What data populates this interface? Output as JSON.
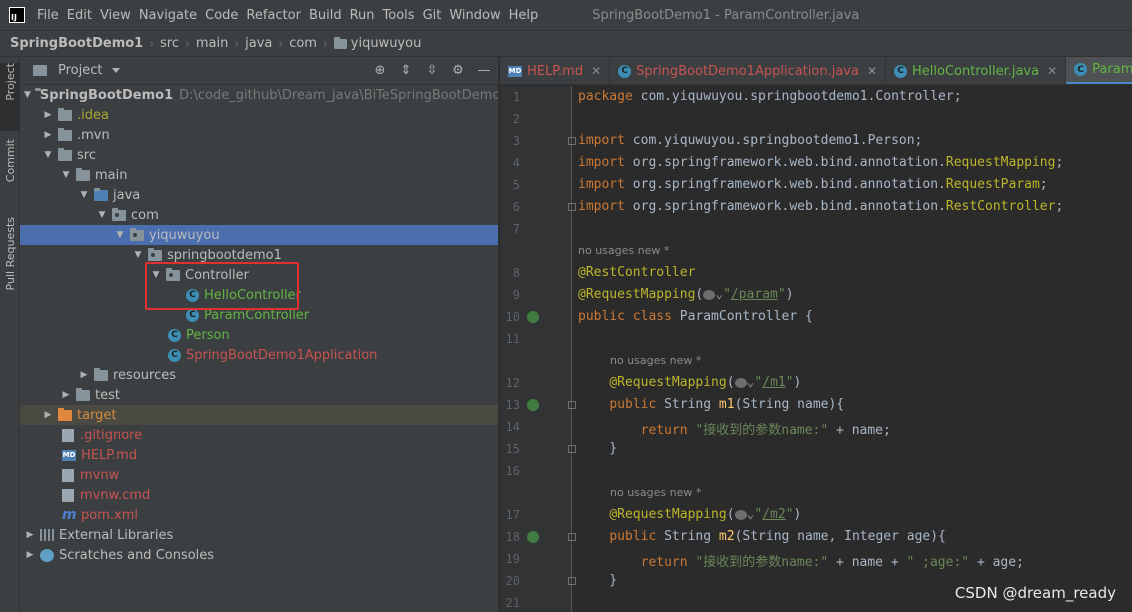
{
  "menubar": {
    "items": [
      "File",
      "Edit",
      "View",
      "Navigate",
      "Code",
      "Refactor",
      "Build",
      "Run",
      "Tools",
      "Git",
      "Window",
      "Help"
    ],
    "window_title": "SpringBootDemo1 - ParamController.java",
    "logo_text": "IJ"
  },
  "breadcrumb": [
    "SpringBootDemo1",
    "src",
    "main",
    "java",
    "com",
    "yiquwuyou"
  ],
  "toolstripe": {
    "project": "Project",
    "commit": "Commit",
    "pull_requests": "Pull Requests"
  },
  "project_panel": {
    "title": "Project",
    "tree": [
      {
        "name": "SpringBootDemo1",
        "extra": "D:\\code_github\\Dream_java\\BiTeSpringBootDemo\\Spri"
      },
      {
        "name": ".idea"
      },
      {
        "name": ".mvn"
      },
      {
        "name": "src"
      },
      {
        "name": "main"
      },
      {
        "name": "java"
      },
      {
        "name": "com"
      },
      {
        "name": "yiquwuyou"
      },
      {
        "name": "springbootdemo1"
      },
      {
        "name": "Controller"
      },
      {
        "name": "HelloController"
      },
      {
        "name": "ParamController"
      },
      {
        "name": "Person"
      },
      {
        "name": "SpringBootDemo1Application"
      },
      {
        "name": "resources"
      },
      {
        "name": "test"
      },
      {
        "name": "target"
      },
      {
        "name": ".gitignore"
      },
      {
        "name": "HELP.md"
      },
      {
        "name": "mvnw"
      },
      {
        "name": "mvnw.cmd"
      },
      {
        "name": "pom.xml"
      },
      {
        "name": "External Libraries"
      },
      {
        "name": "Scratches and Consoles"
      }
    ]
  },
  "editor": {
    "tabs": [
      {
        "label": "HELP.md"
      },
      {
        "label": "SpringBootDemo1Application.java"
      },
      {
        "label": "HelloController.java"
      },
      {
        "label": "ParamController"
      }
    ],
    "hint_text": "no usages   new *",
    "line_numbers": [
      "1",
      "2",
      "3",
      "4",
      "5",
      "6",
      "7",
      "8",
      "9",
      "10",
      "11",
      "12",
      "13",
      "14",
      "15",
      "16",
      "17",
      "18",
      "19",
      "20",
      "21"
    ]
  },
  "watermark": "CSDN @dream_ready"
}
